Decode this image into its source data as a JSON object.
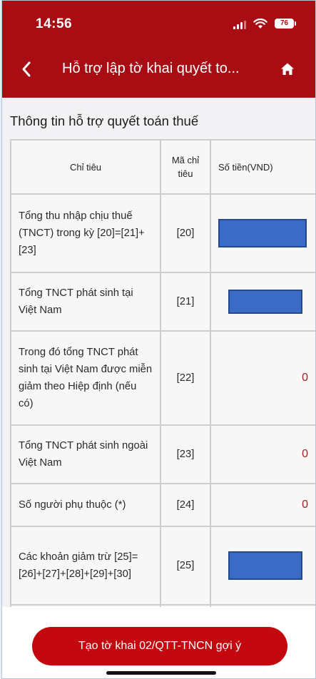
{
  "status_bar": {
    "time": "14:56",
    "battery": "76"
  },
  "nav": {
    "title": "Hỗ trợ lập tờ khai quyết to...",
    "back_icon": "chevron-left-icon",
    "home_icon": "home-icon"
  },
  "section": {
    "title": "Thông tin hỗ trợ quyết toán thuế"
  },
  "table": {
    "headers": [
      "Chỉ tiêu",
      "Mã chỉ tiêu",
      "Số tiền(VND)"
    ],
    "rows": [
      {
        "desc": "Tổng thu nhập chịu thuế (TNCT) trong kỳ [20]=[21]+[23]",
        "code": "[20]",
        "amount": ""
      },
      {
        "desc": "Tổng TNCT phát sinh tại Việt Nam",
        "code": "[21]",
        "amount": ""
      },
      {
        "desc": "Trong đó tổng TNCT phát sinh tại Việt Nam được miễn giảm theo Hiệp định (nếu có)",
        "code": "[22]",
        "amount": "0"
      },
      {
        "desc": "Tổng TNCT phát sinh ngoài Việt Nam",
        "code": "[23]",
        "amount": "0"
      },
      {
        "desc": "Số người phụ thuộc (*)",
        "code": "[24]",
        "amount": "0"
      },
      {
        "desc": "Các khoản giảm trừ [25]=[26]+[27]+[28]+[29]+[30]",
        "code": "[25]",
        "amount": ""
      }
    ]
  },
  "footer": {
    "cta_label": "Tạo tờ khai 02/QTT-TNCN gợi ý"
  },
  "colors": {
    "brand": "#a70d13",
    "button": "#c4080f",
    "redaction": "#3a6cc7"
  }
}
